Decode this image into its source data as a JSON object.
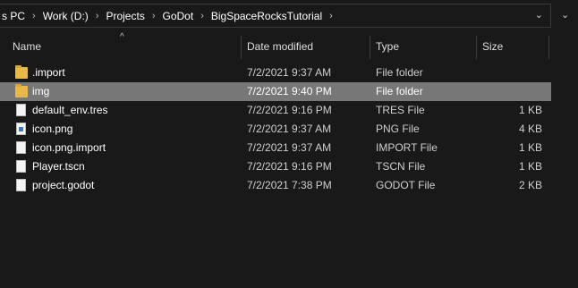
{
  "address": {
    "crumbs": [
      "s PC",
      "Work (D:)",
      "Projects",
      "GoDot",
      "BigSpaceRocksTutorial"
    ],
    "separator": "›",
    "dropdown": "⌄",
    "right_chevron": "›"
  },
  "columns": {
    "name": "Name",
    "date": "Date modified",
    "type": "Type",
    "size": "Size",
    "sort_indicator": "^"
  },
  "files": [
    {
      "name": ".import",
      "date": "7/2/2021 9:37 AM",
      "type": "File folder",
      "size": "",
      "icon": "folder-icon"
    },
    {
      "name": "img",
      "date": "7/2/2021 9:40 PM",
      "type": "File folder",
      "size": "",
      "icon": "folder-icon",
      "selected": true
    },
    {
      "name": "default_env.tres",
      "date": "7/2/2021 9:16 PM",
      "type": "TRES File",
      "size": "1 KB",
      "icon": "file-icon"
    },
    {
      "name": "icon.png",
      "date": "7/2/2021 9:37 AM",
      "type": "PNG File",
      "size": "4 KB",
      "icon": "image-file-icon"
    },
    {
      "name": "icon.png.import",
      "date": "7/2/2021 9:37 AM",
      "type": "IMPORT File",
      "size": "1 KB",
      "icon": "file-icon"
    },
    {
      "name": "Player.tscn",
      "date": "7/2/2021 9:16 PM",
      "type": "TSCN File",
      "size": "1 KB",
      "icon": "file-icon"
    },
    {
      "name": "project.godot",
      "date": "7/2/2021 7:38 PM",
      "type": "GODOT File",
      "size": "2 KB",
      "icon": "file-icon"
    }
  ],
  "colors": {
    "background": "#191919",
    "selection": "#777777",
    "folder": "#e8b949"
  }
}
